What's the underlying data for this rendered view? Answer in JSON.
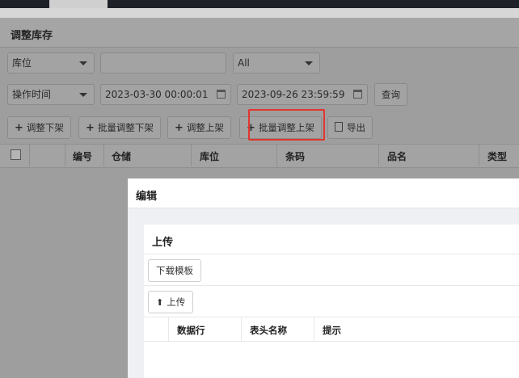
{
  "page": {
    "title": "调整库存"
  },
  "filters": {
    "location_select": "库位",
    "location_input": "",
    "status_select": "All",
    "time_type_select": "操作时间",
    "start_time": "2023-03-30 00:00:01",
    "end_time": "2023-09-26 23:59:59",
    "query_label": "查询"
  },
  "toolbar": {
    "adjust_down": "调整下架",
    "batch_adjust_down": "批量调整下架",
    "adjust_up": "调整上架",
    "batch_adjust_up": "批量调整上架",
    "export": "导出"
  },
  "table": {
    "columns": [
      "编号",
      "仓储",
      "库位",
      "条码",
      "品名",
      "类型"
    ]
  },
  "modal": {
    "title": "编辑",
    "card_title": "上传",
    "download_template": "下载模板",
    "upload": "上传",
    "columns": [
      "数据行",
      "表头名称",
      "提示"
    ]
  },
  "colors": {
    "highlight": "#e3342f"
  }
}
